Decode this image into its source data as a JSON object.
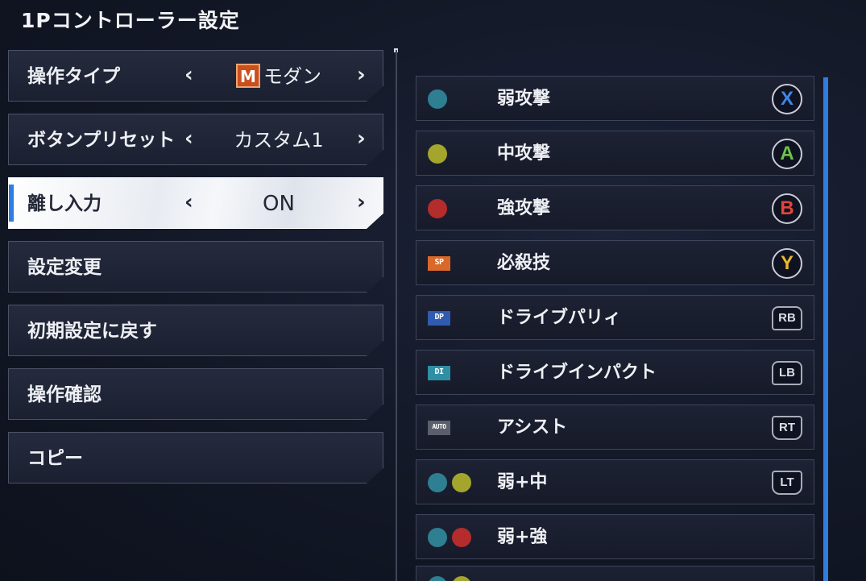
{
  "title": "1Pコントローラー設定",
  "left_menu": {
    "control_type": {
      "label": "操作タイプ",
      "badge": "M",
      "value": "モダン"
    },
    "button_preset": {
      "label": "ボタンプリセット",
      "value": "カスタム1"
    },
    "release_input": {
      "label": "離し入力",
      "value": "ON"
    },
    "change_settings": {
      "label": "設定変更"
    },
    "reset_defaults": {
      "label": "初期設定に戻す"
    },
    "confirm_controls": {
      "label": "操作確認"
    },
    "copy": {
      "label": "コピー"
    },
    "arrow_left": "‹",
    "arrow_right": "›"
  },
  "colors": {
    "light": "#2d7f91",
    "medium": "#a4a52c",
    "heavy": "#b42c2c",
    "sp": "#d9692a",
    "dp": "#2f5bb0",
    "di": "#2f8fa3",
    "auto": "#5a5f6e",
    "accent": "#2f7de0"
  },
  "bindings": [
    {
      "icon": "light-dot",
      "name": "弱攻撃",
      "button": "X",
      "button_color": "#3f86e6",
      "kind": "face"
    },
    {
      "icon": "medium-dot",
      "name": "中攻撃",
      "button": "A",
      "button_color": "#6cc24a",
      "kind": "face"
    },
    {
      "icon": "heavy-dot",
      "name": "強攻撃",
      "button": "B",
      "button_color": "#e0463c",
      "kind": "face"
    },
    {
      "icon": "sp-tag",
      "tag": "SP",
      "name": "必殺技",
      "button": "Y",
      "button_color": "#e8b92c",
      "kind": "face"
    },
    {
      "icon": "dp-tag",
      "tag": "DP",
      "name": "ドライブパリィ",
      "button": "RB",
      "kind": "bumper"
    },
    {
      "icon": "di-tag",
      "tag": "DI",
      "name": "ドライブインパクト",
      "button": "LB",
      "kind": "bumper"
    },
    {
      "icon": "auto-tag",
      "tag": "AUTO",
      "name": "アシスト",
      "button": "RT",
      "kind": "bumper"
    },
    {
      "icon": "light-medium-dots",
      "name": "弱+中",
      "button": "LT",
      "kind": "bumper"
    },
    {
      "icon": "light-heavy-dots",
      "name": "弱+強",
      "button": "",
      "kind": "none"
    }
  ]
}
